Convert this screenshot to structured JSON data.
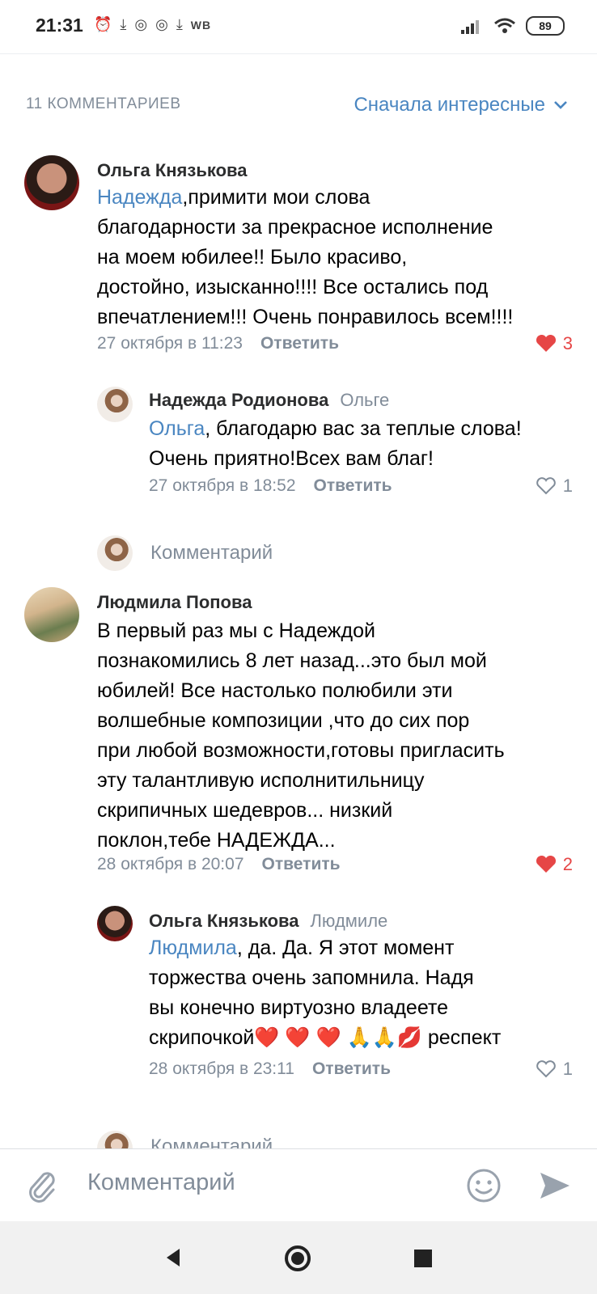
{
  "status": {
    "time": "21:31",
    "wb": "WB",
    "battery": "89"
  },
  "header": {
    "count": "11 КОММЕНТАРИЕВ",
    "sort": "Сначала интересные"
  },
  "comments": [
    {
      "author": "Ольга Князькова",
      "mention": "Надежда",
      "lines": [
        ",примити мои слова",
        "благодарности за прекрасное исполнение",
        "на моем юбилее!! Было красиво,",
        "достойно, изысканно!!!! Все остались под",
        "впечатлением!!! Очень понравилось всем!!!!"
      ],
      "date": "27 октября в 11:23",
      "reply": "Ответить",
      "likes": "3",
      "replies": [
        {
          "author": "Надежда Родионова",
          "to": "Ольге",
          "mention": "Ольга",
          "lines": [
            ", благодарю вас за теплые слова!",
            "Очень приятно!Всех вам благ!"
          ],
          "date": "27 октября в 18:52",
          "reply": "Ответить",
          "likes": "1"
        }
      ],
      "comment_placeholder": "Комментарий"
    },
    {
      "author": "Людмила Попова",
      "lines": [
        "В первый раз мы с Надеждой",
        "познакомились 8 лет назад...это был мой",
        "юбилей! Все настолько полюбили эти",
        "волшебные композиции ,что до сих пор",
        "при любой возможности,готовы пригласить",
        "эту талантливую исполнитильницу",
        "скрипичных шедевров... низкий",
        "поклон,тебе НАДЕЖДА..."
      ],
      "date": "28 октября в 20:07",
      "reply": "Ответить",
      "likes": "2",
      "replies": [
        {
          "author": "Ольга Князькова",
          "to": "Людмиле",
          "mention": "Людмила",
          "lines": [
            ", да. Да. Я этот момент",
            "торжества очень запомнила. Надя",
            "вы конечно виртуозно владеете",
            "скрипочкой❤️ ❤️ ❤️ 🙏🙏💋 респект"
          ],
          "date": "28 октября в 23:11",
          "reply": "Ответить",
          "likes": "1"
        }
      ],
      "comment_placeholder": "Комментарий"
    }
  ],
  "composer": {
    "placeholder": "Комментарий"
  }
}
